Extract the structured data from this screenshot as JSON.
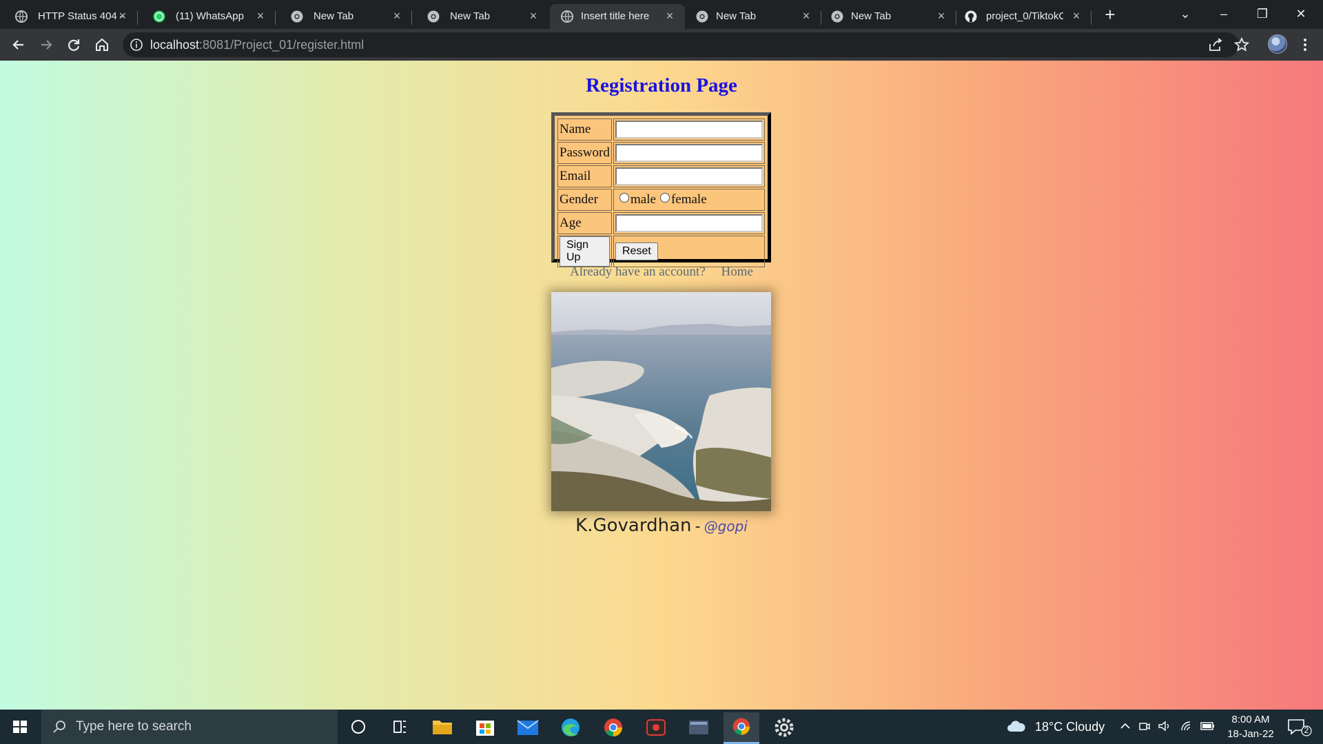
{
  "browser": {
    "tabs": [
      {
        "title": "HTTP Status 404 –",
        "active": false
      },
      {
        "title": "(11) WhatsApp",
        "active": false
      },
      {
        "title": "New Tab",
        "active": false
      },
      {
        "title": "New Tab",
        "active": false
      },
      {
        "title": "Insert title here",
        "active": true
      },
      {
        "title": "New Tab",
        "active": false
      },
      {
        "title": "New Tab",
        "active": false
      },
      {
        "title": "project_0/TiktokC",
        "active": false
      }
    ],
    "url_host": "localhost",
    "url_rest": ":8081/Project_01/register.html"
  },
  "page": {
    "title": "Registration Page",
    "form": {
      "name_label": "Name",
      "password_label": "Password",
      "email_label": "Email",
      "gender_label": "Gender",
      "gender_male": "male",
      "gender_female": "female",
      "age_label": "Age",
      "signup_label": "Sign Up",
      "reset_label": "Reset"
    },
    "link_login": "Already have an account?",
    "link_home": "Home",
    "credit_name": "K.Govardhan",
    "credit_dash": "-",
    "credit_handle": "@gopi"
  },
  "taskbar": {
    "search_placeholder": "Type here to search",
    "weather": "18°C  Cloudy",
    "time": "8:00 AM",
    "date": "18-Jan-22",
    "notification_count": "2"
  }
}
